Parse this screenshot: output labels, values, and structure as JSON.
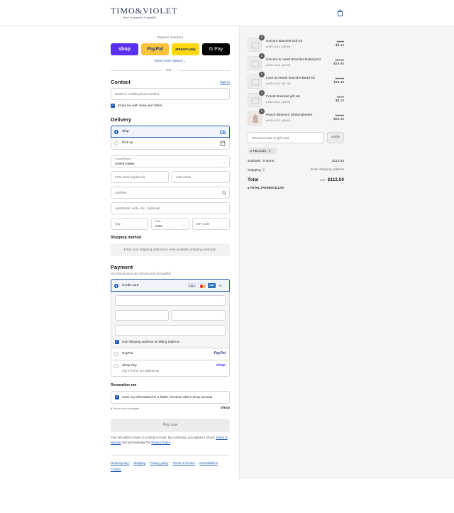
{
  "header": {
    "logo_main": "TIMO&VIOLET",
    "logo_sub": "born to wander & sparkle"
  },
  "express": {
    "label": "Express checkout",
    "buttons": [
      {
        "label": "shop",
        "color": "#5a31f4",
        "text_color": "#ffffff"
      },
      {
        "label": "PayPal",
        "color": "#ffc439",
        "text_color": "#253b80"
      },
      {
        "label": "amazon pay",
        "color": "#ffd814",
        "text_color": "#232f3e"
      },
      {
        "label": "G Pay",
        "color": "#000000",
        "text_color": "#ffffff"
      }
    ],
    "more": "Show more options ⌄",
    "or": "OR"
  },
  "contact": {
    "title": "Contact",
    "sign_in": "Sign in",
    "email_placeholder": "Email or mobile phone number",
    "news_label": "Email me with news and offers"
  },
  "delivery": {
    "title": "Delivery",
    "ship": "Ship",
    "pickup": "Pick up",
    "country_label": "Country/Region",
    "country": "United States",
    "first_name": "First name (optional)",
    "last_name": "Last name",
    "address": "Address",
    "apartment": "Apartment, suite, etc. (optional)",
    "city": "City",
    "state_label": "State",
    "state": "Iowa",
    "zip": "ZIP code"
  },
  "shipping_method": {
    "title": "Shipping method",
    "message": "Enter your shipping address to view available shipping methods."
  },
  "payment": {
    "title": "Payment",
    "subtitle": "All transactions are secure and encrypted.",
    "credit_card": "Credit card",
    "card_more": "+5",
    "billing_same": "Use shipping address as billing address",
    "paypal": "PayPal",
    "paypal_logo": "PayPal",
    "shop_pay": "Shop Pay",
    "shop_pay_sub": "Pay in full or in installments",
    "shop_logo": "shop"
  },
  "remember": {
    "title": "Remember me",
    "save_label": "Save my information for a faster checkout with a Shop account",
    "secure": "Secure and encrypted",
    "shop_logo": "shop"
  },
  "pay_now": "Pay now",
  "legal": {
    "prefix": "Your info will be saved to a Shop account. By continuing, you agree to Shop's",
    "terms": "Terms of Service",
    "middle": "and acknowledge the",
    "privacy": "Privacy Policy",
    "end": "."
  },
  "footer_links": [
    "Refund policy",
    "Shipping",
    "Privacy policy",
    "Terms of service",
    "Cancellations",
    "Contact"
  ],
  "cart": {
    "items": [
      {
        "qty": "1",
        "name": "Unicorn Bracelet Gift Kit",
        "discount": "HELLO10 (-$0.90)",
        "old": "$9.00",
        "price": "$8.10"
      },
      {
        "qty": "1",
        "name": "Unicorn & Heart Bracelet Making Kit",
        "discount": "HELLO10 (-$2.20)",
        "old": "$22.00",
        "price": "$19.80"
      },
      {
        "qty": "1",
        "name": "Love & Hearts Bracelet Bead Kit",
        "discount": "HELLO10 (-$1.70)",
        "old": "$17.00",
        "price": "$15.30"
      },
      {
        "qty": "1",
        "name": "Forest Bracelet gift set",
        "discount": "HELLO10 (-$0.90)",
        "old": "$9.00",
        "price": "$8.10"
      },
      {
        "qty": "1",
        "name": "Peach Blossom Shawl Blanket",
        "discount": "HELLO10 (-$6.80)",
        "old": "$68.00",
        "price": "$61.20"
      }
    ],
    "discount_placeholder": "Discount code or gift card",
    "apply": "Apply",
    "code_tag": "HELLO10",
    "subtotal_label": "Subtotal · 5 items",
    "subtotal": "$112.50",
    "shipping_label": "Shipping",
    "shipping_value": "Enter shipping address",
    "total_label": "Total",
    "currency": "USD",
    "total": "$112.50",
    "savings_label": "TOTAL SAVINGS",
    "savings": "$12.00"
  },
  "colors": {
    "accent": "#1f5bb5",
    "brand": "#26365a"
  }
}
